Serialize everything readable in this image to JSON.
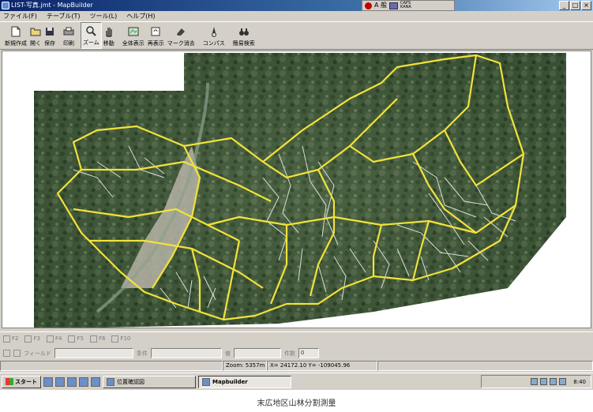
{
  "window": {
    "title": "LIST-写真.jmt - MapBuilder",
    "buttons": [
      "_",
      "□",
      "×"
    ]
  },
  "menu": [
    "ファイル(F)",
    "テーブル(T)",
    "ツール(L)",
    "ヘルプ(H)"
  ],
  "toolbar": [
    {
      "label": "新規作成",
      "icon": "new-file-icon"
    },
    {
      "label": "開く",
      "icon": "open-folder-icon"
    },
    {
      "label": "保存",
      "icon": "save-icon"
    },
    {
      "label": "印刷",
      "icon": "print-icon"
    },
    {
      "label": "ズーム",
      "icon": "zoom-icon",
      "pressed": true
    },
    {
      "label": "移動",
      "icon": "pan-hand-icon"
    },
    {
      "label": "全体表示",
      "icon": "full-extent-icon"
    },
    {
      "label": "再表示",
      "icon": "refresh-icon"
    },
    {
      "label": "マーク消去",
      "icon": "erase-mark-icon"
    },
    {
      "label": "コンパス",
      "icon": "compass-icon"
    },
    {
      "label": "簡易検索",
      "icon": "binoculars-icon"
    }
  ],
  "ime": {
    "mode": "A 般",
    "small_text": "CAPS KANA"
  },
  "function_keys": [
    "F2",
    "F3",
    "F4",
    "F5",
    "F6",
    "F10"
  ],
  "query_bar": {
    "field_label": "フィールド",
    "condition_label": "条件",
    "value_label": "値",
    "count_label": "件数",
    "count_value": "0"
  },
  "status": {
    "zoom": "Zoom: 5357m",
    "coords": "X= 24172.10  Y= -109045.96"
  },
  "taskbar": {
    "start": "スタート",
    "items": [
      {
        "label": "位置確認図",
        "active": false
      },
      {
        "label": "Mapbuilder",
        "active": true
      }
    ],
    "clock": "8:40"
  },
  "caption": "末広地区山林分割測量",
  "colors": {
    "boundary": "#f2e23a",
    "parcel": "#e8e8e8",
    "forest_dark": "#2f4a2c",
    "forest_light": "#8fa47a",
    "window_face": "#d4d0c8",
    "titlebar": "#0a246a"
  }
}
